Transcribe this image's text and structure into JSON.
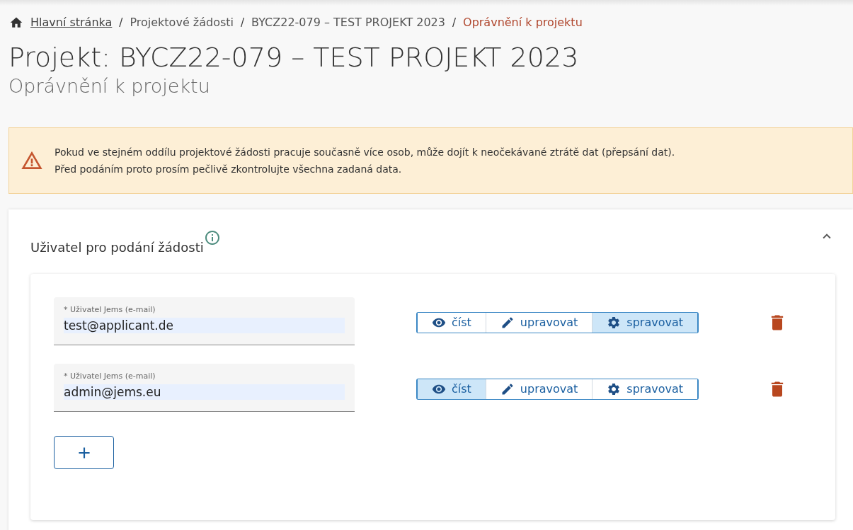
{
  "breadcrumb": [
    {
      "label": "Hlavní stránka",
      "kind": "link"
    },
    {
      "label": "Projektové žádosti",
      "kind": "text"
    },
    {
      "label": "BYCZ22-079 – TEST PROJEKT 2023",
      "kind": "text"
    },
    {
      "label": "Oprávnění k projektu",
      "kind": "current"
    }
  ],
  "breadcrumb_separator": "/",
  "title": "Projekt: BYCZ22-079 – TEST PROJEKT 2023",
  "subtitle": "Oprávnění k projektu",
  "warning": [
    "Pokud ve stejném oddílu projektové žádosti pracuje současně více osob, může dojít k neočekávané ztrátě dat (přepsání dat).",
    "Před podáním proto prosím pečlivě zkontrolujte všechna zadaná data."
  ],
  "section": {
    "title": "Uživatel pro podání žádosti",
    "expanded": true,
    "users": [
      {
        "label": "Uživatel Jems (e-mail)",
        "required_mark": "*",
        "value": "test@applicant.de",
        "permissions": [
          {
            "kind": "read",
            "label": "číst",
            "selected": false
          },
          {
            "kind": "edit",
            "label": "upravovat",
            "selected": false
          },
          {
            "kind": "manage",
            "label": "spravovat",
            "selected": true
          }
        ]
      },
      {
        "label": "Uživatel Jems (e-mail)",
        "required_mark": "*",
        "value": "admin@jems.eu",
        "permissions": [
          {
            "kind": "read",
            "label": "číst",
            "selected": true
          },
          {
            "kind": "edit",
            "label": "upravovat",
            "selected": false
          },
          {
            "kind": "manage",
            "label": "spravovat",
            "selected": false
          }
        ]
      }
    ]
  }
}
